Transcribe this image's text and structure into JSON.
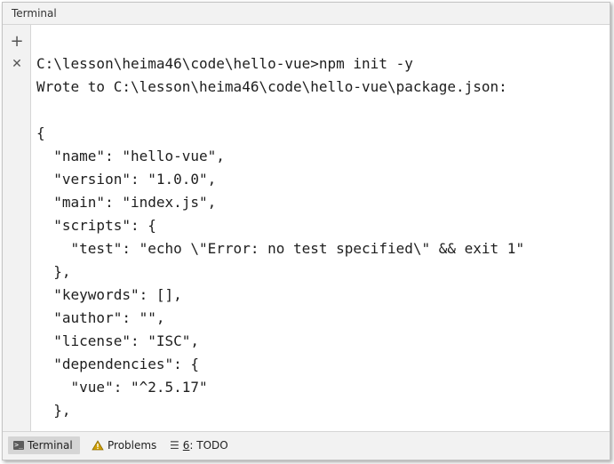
{
  "window": {
    "title": "Terminal"
  },
  "gutter": {
    "add_glyph": "+",
    "close_glyph": "✕"
  },
  "terminal": {
    "lines": [
      "C:\\lesson\\heima46\\code\\hello-vue>npm init -y",
      "Wrote to C:\\lesson\\heima46\\code\\hello-vue\\package.json:",
      "",
      "{",
      "  \"name\": \"hello-vue\",",
      "  \"version\": \"1.0.0\",",
      "  \"main\": \"index.js\",",
      "  \"scripts\": {",
      "    \"test\": \"echo \\\"Error: no test specified\\\" && exit 1\"",
      "  },",
      "  \"keywords\": [],",
      "  \"author\": \"\",",
      "  \"license\": \"ISC\",",
      "  \"dependencies\": {",
      "    \"vue\": \"^2.5.17\"",
      "  },"
    ]
  },
  "bottom_tabs": {
    "terminal": "Terminal",
    "problems": "Problems",
    "todo_num": "6",
    "todo_rest": ": TODO"
  }
}
